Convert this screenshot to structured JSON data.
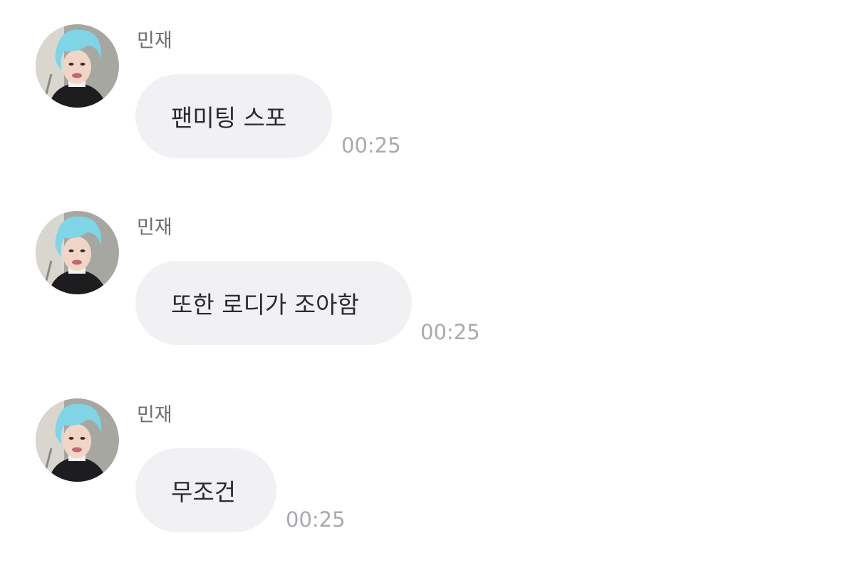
{
  "messages": [
    {
      "sender": "민재",
      "text": "팬미팅 스포",
      "time": "00:25",
      "avatar_icon": "profile-photo"
    },
    {
      "sender": "민재",
      "text": "또한 로디가 조아함",
      "time": "00:25",
      "avatar_icon": "profile-photo"
    },
    {
      "sender": "민재",
      "text": "무조건",
      "time": "00:25",
      "avatar_icon": "profile-photo"
    }
  ],
  "colors": {
    "background": "#ffffff",
    "bubble": "#f1f1f4",
    "sender_text": "#6d6d72",
    "message_text": "#2b2b2e",
    "time_text": "#a9a9ae",
    "hair": "#7fd4e6"
  }
}
